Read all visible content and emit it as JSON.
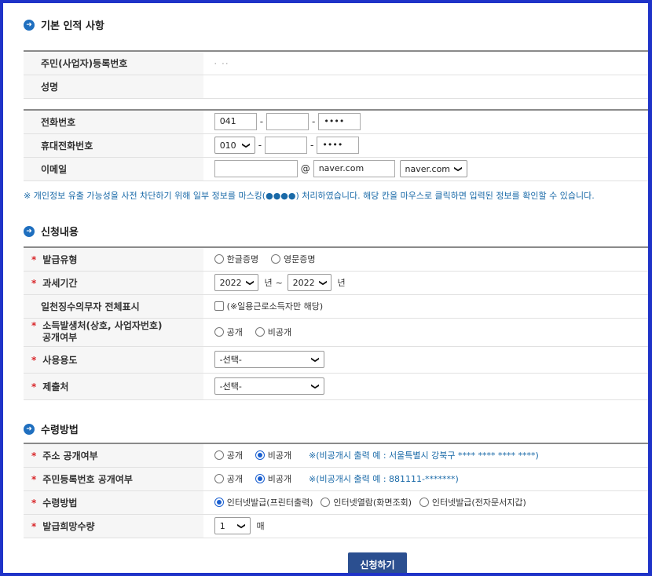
{
  "section_basic": {
    "title": "기본 인적 사항"
  },
  "basic": {
    "resident_id_label": "주민(사업자)등록번호",
    "resident_id_value": "· ··",
    "name_label": "성명",
    "name_value": ""
  },
  "contact": {
    "phone_label": "전화번호",
    "phone": [
      "041",
      "",
      "••••"
    ],
    "mobile_label": "휴대전화번호",
    "mobile_prefix": "010",
    "mobile": [
      "",
      "••••"
    ],
    "email_label": "이메일",
    "email_id": "",
    "email_at": "@",
    "email_domain": "naver.com",
    "email_select": "naver.com",
    "dash": "-"
  },
  "privacy_note": "※ 개인정보 유출 가능성을 사전 차단하기 위해 일부 정보를 마스킹(●●●●) 처리하였습니다. 해당 칸을 마우스로 클릭하면 입력된 정보를 확인할 수 있습니다.",
  "section_apply": {
    "title": "신청내용"
  },
  "apply": {
    "issue_type_label": "발급유형",
    "issue_options": [
      "한글증명",
      "영문증명"
    ],
    "tax_period_label": "과세기간",
    "year_from": "2022",
    "year_to": "2022",
    "year_unit": "년",
    "tilde": "~",
    "daily_label": "일천징수의무자 전체표시",
    "daily_check_text": "(※일용근로소득자만 해당)",
    "disclose_label_1": "소득발생처(상호, 사업자번호)",
    "disclose_label_2": "공개여부",
    "disclose_options": [
      "공개",
      "비공개"
    ],
    "usage_label": "사용용도",
    "usage_value": "-선택-",
    "submit_to_label": "제출처",
    "submit_to_value": "-선택-"
  },
  "section_receive": {
    "title": "수령방법"
  },
  "receive": {
    "address_label": "주소 공개여부",
    "address_options": [
      "공개",
      "비공개"
    ],
    "address_note": "※(비공개시 출력 예 : 서울특별시 강북구 **** **** **** ****)",
    "rrn_label": "주민등록번호 공개여부",
    "rrn_options": [
      "공개",
      "비공개"
    ],
    "rrn_note": "※(비공개시 출력 예 : 881111-*******)",
    "method_label": "수령방법",
    "method_options": [
      "인터넷발급(프린터출력)",
      "인터넷열람(화면조회)",
      "인터넷발급(전자문서지갑)"
    ],
    "copies_label": "발급희망수량",
    "copies_value": "1",
    "copies_unit": "매"
  },
  "submit_button": "신청하기",
  "colors": {
    "frame": "#1f33c8",
    "accent": "#1a6aa8",
    "required": "#d9272b",
    "button": "#2b4f90"
  }
}
